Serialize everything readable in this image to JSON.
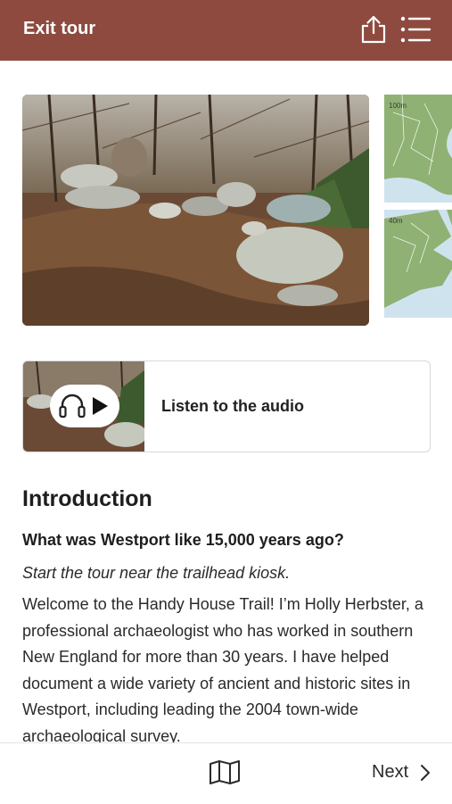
{
  "header": {
    "exit_label": "Exit tour",
    "bg_color": "#8e4a3f",
    "icons": [
      "share-icon",
      "menu-icon"
    ]
  },
  "carousel": {
    "hero_alt": "stone feature in forest",
    "side_maps": [
      {
        "label": "100m"
      },
      {
        "label": "40m"
      }
    ]
  },
  "audio": {
    "label": "Listen to the audio",
    "icons": [
      "headphones-icon",
      "play-icon"
    ]
  },
  "content": {
    "heading": "Introduction",
    "question": "What was Westport like 15,000 years ago?",
    "start_note": "Start the tour near the trailhead kiosk.",
    "body": "Welcome to the Handy House Trail! I’m Holly Herbster, a professional archaeologist who has worked in southern New England for more than 30 years. I have helped document a wide variety of ancient and historic sites in Westport, including leading the 2004 town-wide archaeological survey."
  },
  "footer": {
    "next_label": "Next",
    "icons": [
      "map-icon",
      "chevron-right-icon"
    ]
  }
}
